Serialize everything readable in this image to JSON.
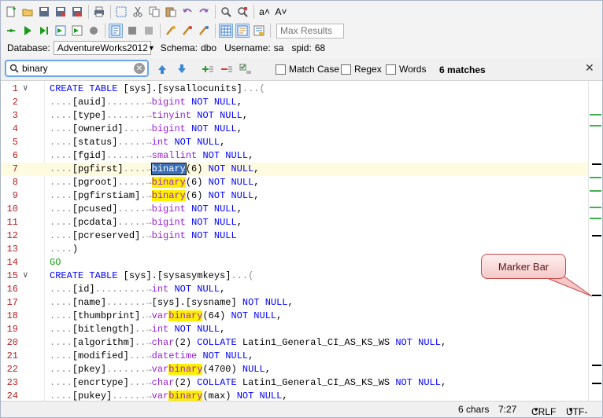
{
  "toolbar1": {
    "icons": [
      "new-file-icon",
      "open-folder-icon",
      "save-icon",
      "save-as-icon",
      "save-all-icon",
      "print-icon",
      "select-all-icon",
      "cut-icon",
      "copy-icon",
      "paste-icon",
      "undo-icon",
      "redo-icon",
      "find-icon",
      "find-replace-icon",
      "increase-font-icon",
      "decrease-font-icon"
    ],
    "font_up": "a˄",
    "font_down": "A˅"
  },
  "toolbar2": {
    "max_results_placeholder": "Max Results"
  },
  "database_bar": {
    "database_label": "Database:",
    "database_value": "AdventureWorks2012",
    "schema_label": "Schema:",
    "schema_value": "dbo",
    "username_label": "Username:",
    "username_value": "sa",
    "spid_label": "spid:",
    "spid_value": "68"
  },
  "find": {
    "query": "binary",
    "match_case": "Match Case",
    "regex": "Regex",
    "words": "Words",
    "matches": "6 matches"
  },
  "editor": {
    "lines": [
      {
        "n": "1",
        "fold": "∨"
      },
      {
        "n": "2"
      },
      {
        "n": "3"
      },
      {
        "n": "4"
      },
      {
        "n": "5"
      },
      {
        "n": "6"
      },
      {
        "n": "7",
        "current": true
      },
      {
        "n": "8"
      },
      {
        "n": "9"
      },
      {
        "n": "10"
      },
      {
        "n": "11"
      },
      {
        "n": "12"
      },
      {
        "n": "13"
      },
      {
        "n": "14"
      },
      {
        "n": "15",
        "fold": "∨"
      },
      {
        "n": "16"
      },
      {
        "n": "17"
      },
      {
        "n": "18"
      },
      {
        "n": "19"
      },
      {
        "n": "20"
      },
      {
        "n": "21"
      },
      {
        "n": "22"
      },
      {
        "n": "23"
      },
      {
        "n": "24"
      }
    ]
  },
  "callout": {
    "text": "Marker Bar"
  },
  "status": {
    "selection": "6 chars",
    "position": "7:27",
    "eol": "CRLF",
    "encoding": "UTF-8"
  },
  "colors": {
    "keyword": "#0000ff",
    "type": "#9a1fd6",
    "line_number": "#b12222",
    "highlight": "#ffef00",
    "current_line": "#fffbe0"
  }
}
